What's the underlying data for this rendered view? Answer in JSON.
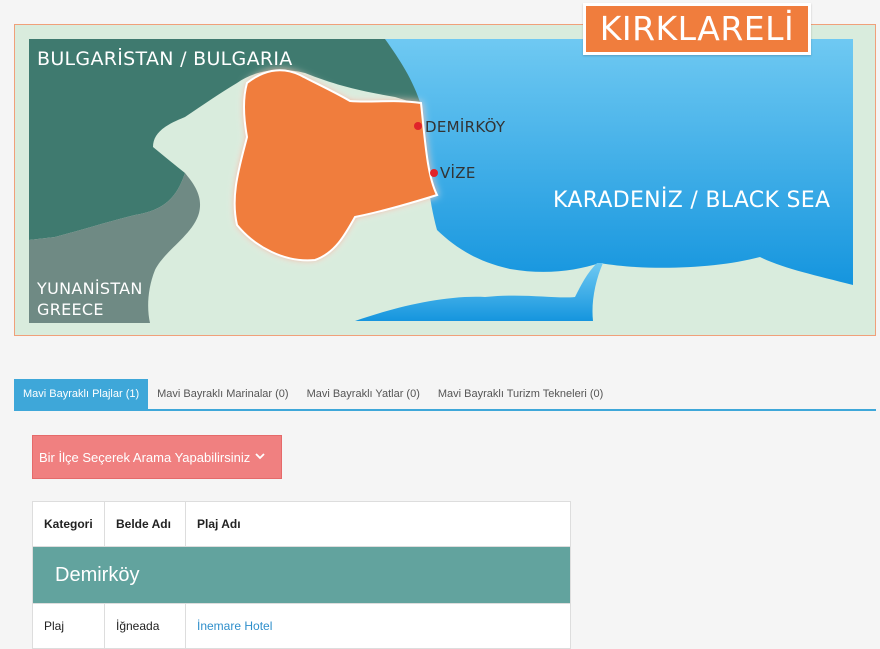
{
  "map": {
    "title": "KIRKLARELİ",
    "regions": {
      "bulgaria": "BULGARİSTAN / BULGARIA",
      "greece_line1": "YUNANİSTAN",
      "greece_line2": "GREECE",
      "sea": "KARADENİZ / BLACK SEA"
    },
    "cities": [
      "DEMİRKÖY",
      "VİZE"
    ],
    "colors": {
      "province": "#f07d3d",
      "neighbor_bulgaria": "#3f7a6f",
      "neighbor_greece": "#6f8a84",
      "land": "#d9ecdd",
      "sea": "#1ea3e6",
      "city_dot": "#e0242a"
    }
  },
  "tabs": [
    {
      "label": "Mavi Bayraklı Plajlar (1)",
      "active": true
    },
    {
      "label": "Mavi Bayraklı Marinalar (0)",
      "active": false
    },
    {
      "label": "Mavi Bayraklı Yatlar (0)",
      "active": false
    },
    {
      "label": "Mavi Bayraklı Turizm Tekneleri (0)",
      "active": false
    }
  ],
  "filter": {
    "label": "Bir İlçe Seçerek Arama Yapabilirsiniz",
    "icon": "chevron-down-icon"
  },
  "table": {
    "headers": [
      "Kategori",
      "Belde Adı",
      "Plaj Adı"
    ],
    "groups": [
      {
        "name": "Demirköy",
        "rows": [
          {
            "category": "Plaj",
            "town": "İğneada",
            "beach": "İnemare Hotel"
          }
        ]
      }
    ]
  },
  "accent": "#3ea7d9"
}
